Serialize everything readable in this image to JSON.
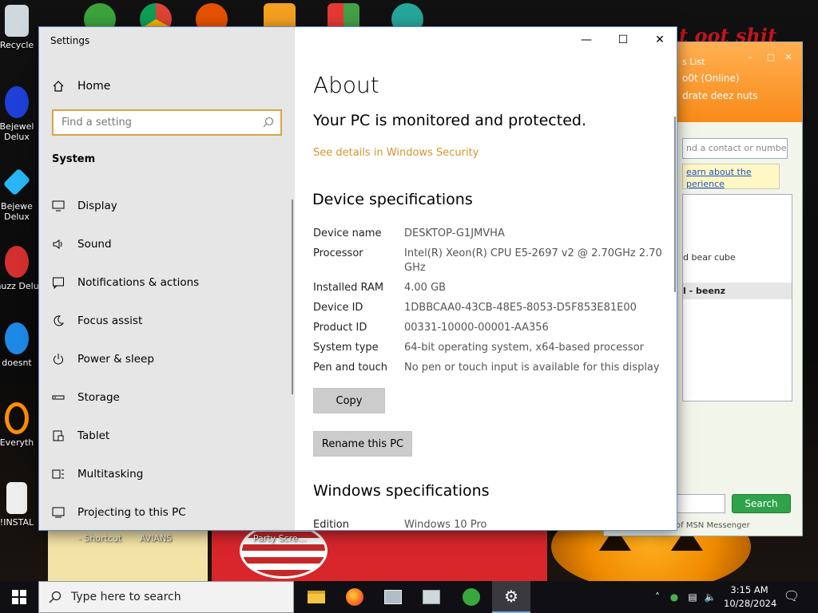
{
  "desktop": {
    "icons": [
      {
        "label": "Recycle"
      },
      {
        "label": "Bejewel Delux"
      },
      {
        "label": "Bejewe Delux"
      },
      {
        "label": "Chuzz Delux"
      },
      {
        "label": "doesnt"
      },
      {
        "label": "Everyth"
      },
      {
        "label": "!INSTAL"
      }
    ],
    "bottom_labels": [
      "- Shortcut",
      "AVIANS",
      "Party Scre..."
    ],
    "banner_text": "t oot shit"
  },
  "msn": {
    "user_line": "s List",
    "status_line": "o0t (Online)",
    "personal_message": "drate deez nuts",
    "search_contacts_placeholder": "nd a contact or numbe",
    "tip_text": "earn about the perience",
    "contact_1": "d bear cube",
    "contact_2": "l - beenz",
    "search_button": "Search",
    "footer_text": "of MSN Messenger"
  },
  "settings": {
    "window_title": "Settings",
    "sidebar": {
      "home_label": "Home",
      "search_placeholder": "Find a setting",
      "section_title": "System",
      "items": [
        {
          "label": "Display",
          "icon": "monitor-icon"
        },
        {
          "label": "Sound",
          "icon": "speaker-icon"
        },
        {
          "label": "Notifications & actions",
          "icon": "notification-icon"
        },
        {
          "label": "Focus assist",
          "icon": "moon-icon"
        },
        {
          "label": "Power & sleep",
          "icon": "power-icon"
        },
        {
          "label": "Storage",
          "icon": "storage-icon"
        },
        {
          "label": "Tablet",
          "icon": "tablet-icon"
        },
        {
          "label": "Multitasking",
          "icon": "multitasking-icon"
        },
        {
          "label": "Projecting to this PC",
          "icon": "projector-icon"
        }
      ]
    },
    "about": {
      "title": "About",
      "protection_status": "Your PC is monitored and protected.",
      "security_link": "See details in Windows Security",
      "device_spec_heading": "Device specifications",
      "specs": [
        {
          "key": "Device name",
          "value": "DESKTOP-G1JMVHA"
        },
        {
          "key": "Processor",
          "value": "Intel(R) Xeon(R) CPU E5-2697 v2 @ 2.70GHz   2.70 GHz"
        },
        {
          "key": "Installed RAM",
          "value": "4.00 GB"
        },
        {
          "key": "Device ID",
          "value": "1DBBCAA0-43CB-48E5-8053-D5F853E81E00"
        },
        {
          "key": "Product ID",
          "value": "00331-10000-00001-AA356"
        },
        {
          "key": "System type",
          "value": "64-bit operating system, x64-based processor"
        },
        {
          "key": "Pen and touch",
          "value": "No pen or touch input is available for this display"
        }
      ],
      "copy_button": "Copy",
      "rename_button": "Rename this PC",
      "windows_spec_heading": "Windows specifications",
      "edition_key": "Edition",
      "edition_value": "Windows 10 Pro"
    }
  },
  "taskbar": {
    "search_placeholder": "Type here to search",
    "apps": [
      "file-explorer-icon",
      "firefox-icon",
      "network-app-icon",
      "computer-app-icon",
      "msn-messenger-icon",
      "settings-gear-icon"
    ],
    "time": "3:15 AM",
    "date": "10/28/2024"
  },
  "colors": {
    "accent_orange": "#d6952e",
    "sidebar_bg": "#e6e6e6",
    "msn_header": "#f98a18"
  }
}
